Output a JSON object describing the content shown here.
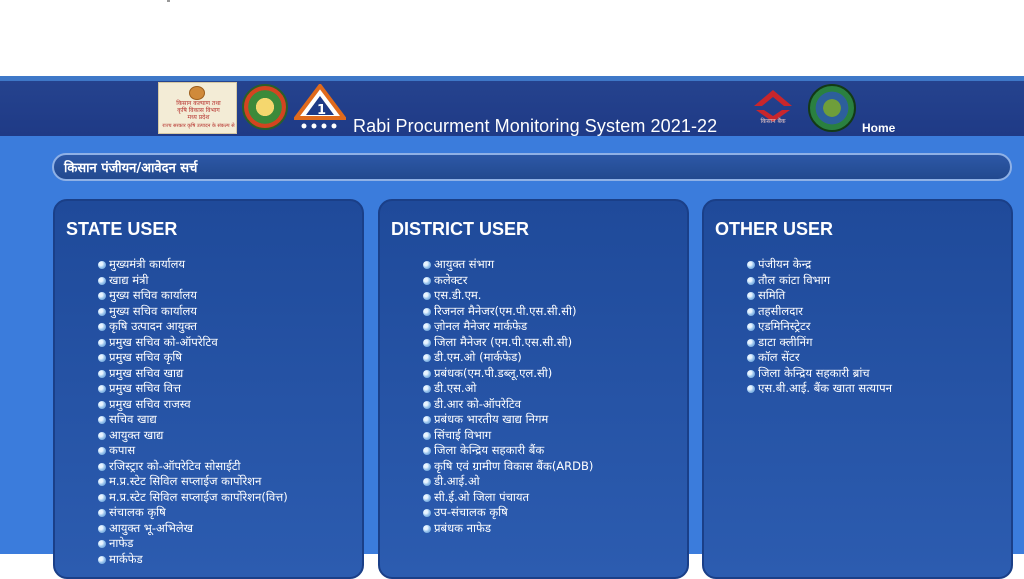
{
  "header": {
    "title": "Rabi Procurment Monitoring System 2021-22",
    "home_label": "Home",
    "logo_kisan_lines": [
      "किसान कल्याण तथा",
      "कृषि विकास विभाग",
      "मध्य प्रदेश",
      "राज्य सरकार कृषि उत्पादन के संकल्प से"
    ],
    "bank_text": "किसान बैंक"
  },
  "search": {
    "label": "किसान पंजीयन/आवेदन सर्च"
  },
  "panels": {
    "state": {
      "title": "STATE USER",
      "items": [
        "मुख्यमंत्री कार्यालय",
        "खाद्य मंत्री",
        "मुख्य सचिव कार्यालय",
        "मुख्य सचिव कार्यालय",
        "कृषि उत्पादन आयुक्त",
        "प्रमुख सचिव को-ऑपरेटिव",
        "प्रमुख सचिव कृषि",
        "प्रमुख सचिव खाद्य",
        "प्रमुख सचिव वित्त",
        "प्रमुख सचिव राजस्व",
        "सचिव खाद्य",
        "आयुक्त खाद्य",
        "कपास",
        "रजिस्ट्रार को-ऑपरेटिव सोसाईटी",
        "म.प्र.स्टेट सिविल सप्लाईज कार्पोरेशन",
        "म.प्र.स्टेट सिविल सप्लाईज कार्पोरेशन(वित्त)",
        "संचालक कृषि",
        "आयुक्त भू-अभिलेख",
        "नाफेड",
        "मार्कफेड"
      ]
    },
    "district": {
      "title": "DISTRICT USER",
      "items": [
        "आयुक्त संभाग",
        "कलेक्टर",
        "एस.डी.एम.",
        "रिजनल मैनेजर(एम.पी.एस.सी.सी)",
        "ज़ोनल मैनेजर मार्कफेड",
        "जिला मैनेजर (एम.पी.एस.सी.सी)",
        "डी.एम.ओ (मार्कफेड)",
        "प्रबंधक(एम.पी.डब्लू.एल.सी)",
        "डी.एस.ओ",
        "डी.आर को-ऑपरेटिव",
        "प्रबंधक भारतीय खाद्य निगम",
        "सिंचाई विभाग",
        "जिला केन्द्रिय सहकारी बैंक",
        "कृषि एवं ग्रामीण विकास बैंक(ARDB)",
        "डी.आई.ओ",
        "सी.ई.ओ जिला पंचायत",
        "उप-संचालक कृषि",
        "प्रबंधक नाफेड"
      ]
    },
    "other": {
      "title": "OTHER USER",
      "items": [
        "पंजीयन केन्द्र",
        "तौल कांटा विभाग",
        "समिति",
        "तहसीलदार",
        "एडमिनिस्ट्रेटर",
        "डाटा क्लीनिंग",
        "कॉल सेंटर",
        "जिला केन्द्रिय सहकारी ब्रांच",
        "एस.बी.आई. बैंक खाता सत्यापन"
      ]
    }
  },
  "colors": {
    "header_bg": "#22418c",
    "main_bg": "#3b7cdc",
    "panel_bg": "#22509f",
    "accent_red": "#c8262c"
  }
}
